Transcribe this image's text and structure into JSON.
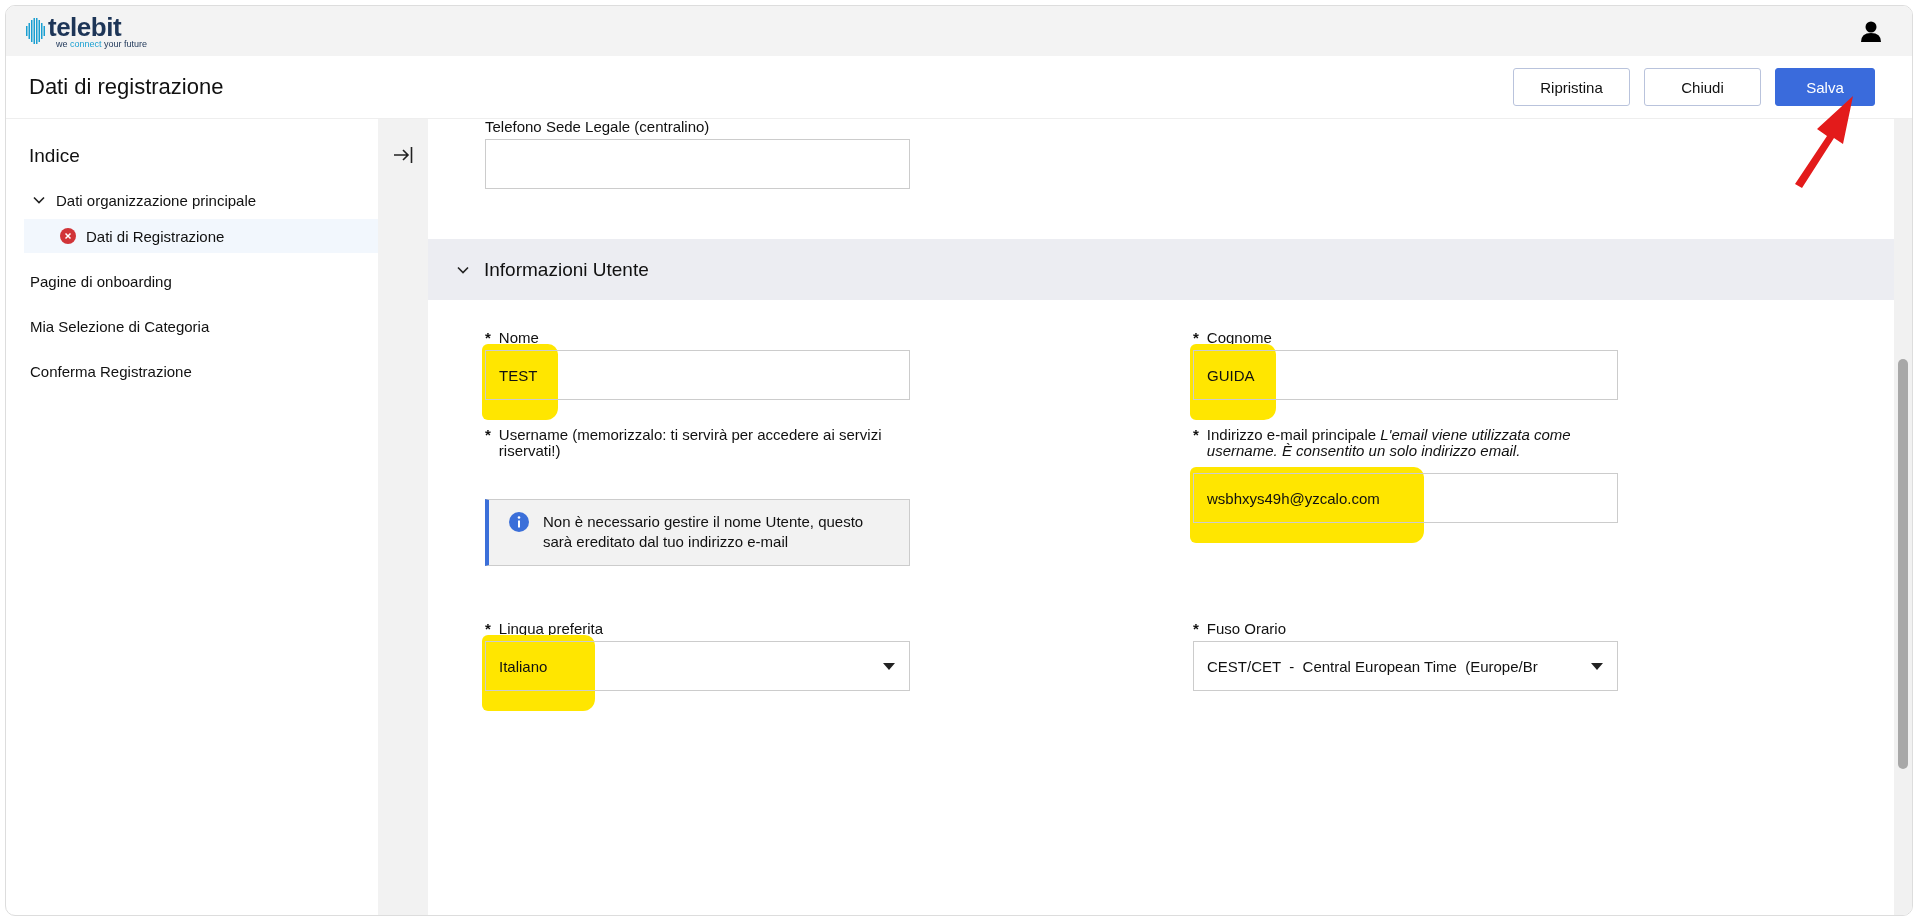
{
  "header": {
    "logo": {
      "name": "telebit",
      "tagline_start": "we ",
      "tagline_accent": "connect",
      "tagline_end": " your future"
    }
  },
  "title_bar": {
    "title": "Dati di registrazione",
    "buttons": [
      {
        "label": "Ripristina",
        "kind": "secondary"
      },
      {
        "label": "Chiudi",
        "kind": "secondary"
      },
      {
        "label": "Salva",
        "kind": "primary"
      }
    ],
    "annotation_arrow": true
  },
  "sidebar": {
    "heading": "Indice",
    "items": [
      {
        "label": "Dati organizzazione principale",
        "selected": false,
        "expanded": true,
        "children": [
          {
            "label": "Dati di Registrazione",
            "selected": true,
            "error": true
          }
        ]
      },
      {
        "label": "Pagine di onboarding",
        "selected": false
      },
      {
        "label": "Mia Selezione di Categoria",
        "selected": false
      },
      {
        "label": "Conferma Registrazione",
        "selected": false
      }
    ]
  },
  "content": {
    "top_field": {
      "label": "Telefono Sede Legale (centralino)"
    },
    "section": {
      "title": "Informazioni Utente",
      "expanded": true
    },
    "fields": [
      {
        "kind": "text",
        "label": "Nome",
        "required_mark": "*",
        "value": "TEST",
        "highlighted": true
      },
      {
        "kind": "text",
        "label": "Cognome",
        "required_mark": "*",
        "value": "GUIDA",
        "highlighted": true
      },
      {
        "kind": "info",
        "label": "Username (memorizzalo: ti servirà per accedere ai servizi riservati!)",
        "required_mark": "*",
        "message": "Non è necessario gestire il nome Utente, questo sarà ereditato dal tuo indirizzo e-mail"
      },
      {
        "kind": "text",
        "label": "Indirizzo e-mail principale *L'email viene utilizzata come username. È consentito un solo indirizzo email.*",
        "required_mark": "*",
        "value": "wsbhxys49h@yzcalo.com",
        "highlighted": true
      },
      {
        "kind": "select",
        "label": "Lingua preferita",
        "required_mark": "*",
        "value": "Italiano",
        "highlighted": true
      },
      {
        "kind": "select",
        "label": "Fuso Orario",
        "required_mark": "*",
        "value": "CEST/CET  -  Central European Time  (Europe/Br",
        "highlighted": false
      }
    ]
  }
}
